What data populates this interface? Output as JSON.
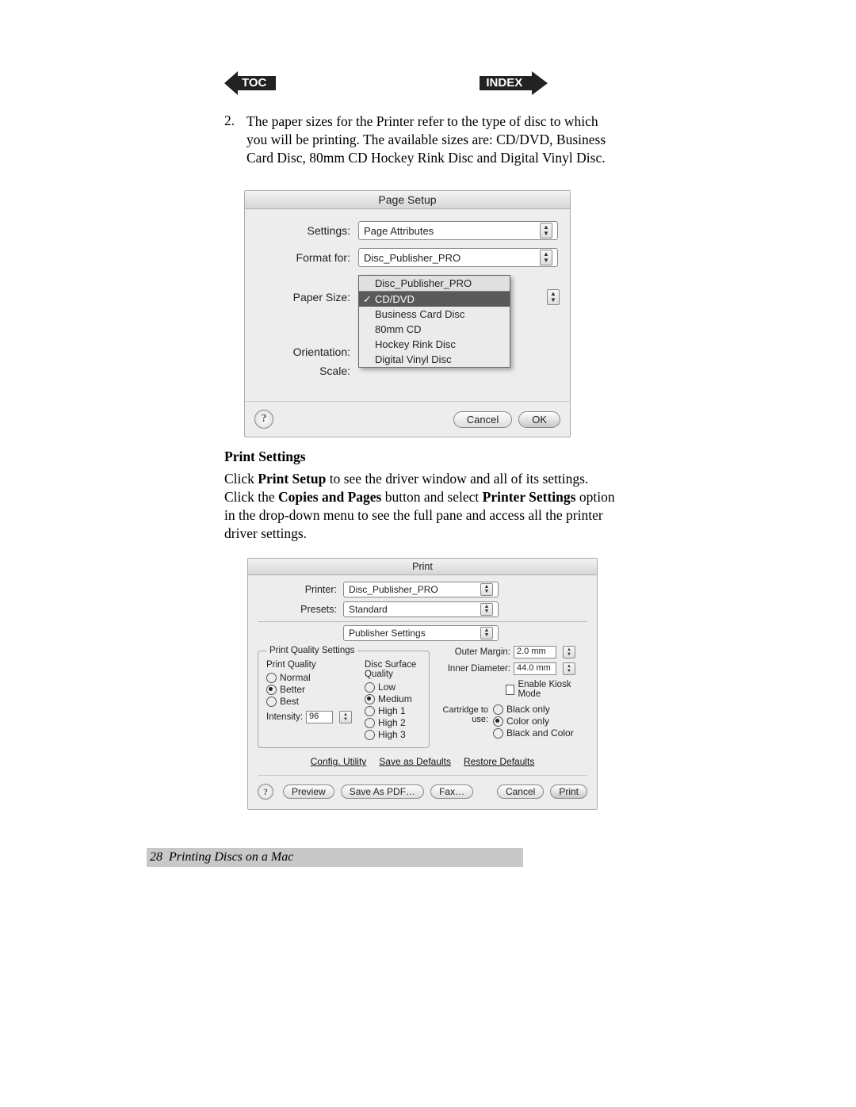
{
  "nav": {
    "toc": "TOC",
    "index": "INDEX"
  },
  "step2": {
    "num": "2.",
    "text": "The paper sizes for the Printer refer to the type of disc to which you will be printing.  The available sizes are: CD/DVD, Business Card Disc, 80mm CD Hockey Rink Disc and Digital Vinyl Disc."
  },
  "page_setup": {
    "title": "Page Setup",
    "rows": {
      "settings_label": "Settings:",
      "settings_value": "Page Attributes",
      "format_for_label": "Format for:",
      "format_for_value": "Disc_Publisher_PRO",
      "paper_size_label": "Paper Size:",
      "orientation_label": "Orientation:",
      "scale_label": "Scale:"
    },
    "paper_menu": {
      "header": "Disc_Publisher_PRO",
      "items": [
        "CD/DVD",
        "Business Card Disc",
        "80mm CD",
        "Hockey Rink Disc",
        "Digital Vinyl Disc"
      ],
      "selected_index": 0
    },
    "buttons": {
      "help": "?",
      "cancel": "Cancel",
      "ok": "OK"
    }
  },
  "section_heading": "Print Settings",
  "print_text": {
    "p1a": "Click ",
    "p1b": "Print Setup",
    "p1c": " to see the driver window and all of its settings. Click the ",
    "p1d": "Copies and Pages",
    "p1e": " button and select ",
    "p1f": "Printer Settings",
    "p1g": " option in the drop-down menu to see the full pane and access all the printer driver settings."
  },
  "print_dialog": {
    "title": "Print",
    "printer_label": "Printer:",
    "printer_value": "Disc_Publisher_PRO",
    "presets_label": "Presets:",
    "presets_value": "Standard",
    "pane_value": "Publisher Settings",
    "quality_legend": "Print Quality Settings",
    "quality_col1_head": "Print Quality",
    "quality_col1_items": [
      "Normal",
      "Better",
      "Best"
    ],
    "quality_col1_selected": 1,
    "quality_col2_head": "Disc Surface Quality",
    "quality_col2_items": [
      "Low",
      "Medium",
      "High 1",
      "High 2",
      "High 3"
    ],
    "quality_col2_selected": 1,
    "intensity_label": "Intensity:",
    "intensity_value": "96",
    "outer_margin_label": "Outer Margin:",
    "outer_margin_value": "2.0 mm",
    "inner_diameter_label": "Inner Diameter:",
    "inner_diameter_value": "44.0 mm",
    "kiosk_label": "Enable Kiosk Mode",
    "cartridge_label": "Cartridge to use:",
    "cartridge_items": [
      "Black only",
      "Color only",
      "Black and Color"
    ],
    "cartridge_selected": 1,
    "config_utility": "Config. Utility",
    "save_defaults": "Save as Defaults",
    "restore_defaults": "Restore Defaults",
    "buttons": {
      "help": "?",
      "preview": "Preview",
      "save_pdf": "Save As PDF…",
      "fax": "Fax…",
      "cancel": "Cancel",
      "print": "Print"
    }
  },
  "page_footer": {
    "num": "28",
    "title": "Printing Discs on a Mac"
  }
}
